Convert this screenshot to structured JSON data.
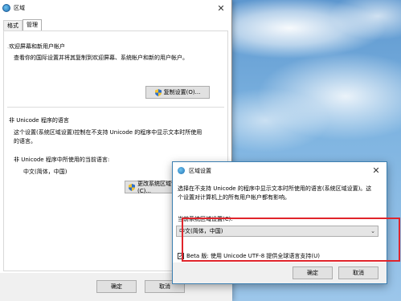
{
  "main_window": {
    "title": "区域",
    "close_glyph": "✕",
    "tabs": [
      {
        "label": "格式",
        "active": false
      },
      {
        "label": "管理",
        "active": true
      }
    ],
    "welcome": {
      "group_title": "欢迎屏幕和新用户帐户",
      "description": "查看你的国际设置并将其复制到欢迎屏幕、系统帐户和新的用户帐户。",
      "copy_button": "复制设置(O)..."
    },
    "non_unicode": {
      "group_title": "非 Unicode 程序的语言",
      "description_line1": "这个设置(系统区域设置)控制在不支持 Unicode 的程序中显示文本时所使用",
      "description_line2": "的语言。",
      "current_label": "非 Unicode 程序中所使用的当前语言:",
      "current_value": "中文(简体，中国)",
      "change_button": "更改系统区域设置(C)..."
    },
    "footer": {
      "ok": "确定",
      "cancel": "取消"
    }
  },
  "dialog": {
    "title": "区域设置",
    "close_glyph": "✕",
    "description_line1": "选择在不支持 Unicode 的程序中显示文本时所使用的语言(系统区域设置)。这",
    "description_line2": "个设置对计算机上的所有用户帐户都有影响。",
    "locale_label": "当前系统区域设置(C):",
    "locale_value": "中文(简体，中国)",
    "dropdown_arrow": "⌄",
    "beta_checked": true,
    "checkbox_mark": "✓",
    "beta_label": "Beta 版: 使用 Unicode UTF-8 提供全球语言支持(U)",
    "ok": "确定",
    "cancel": "取消"
  },
  "colors": {
    "highlight_box": "#e0242b",
    "dialog_border": "#3c7fb1",
    "button_face": "#e1e1e1"
  }
}
